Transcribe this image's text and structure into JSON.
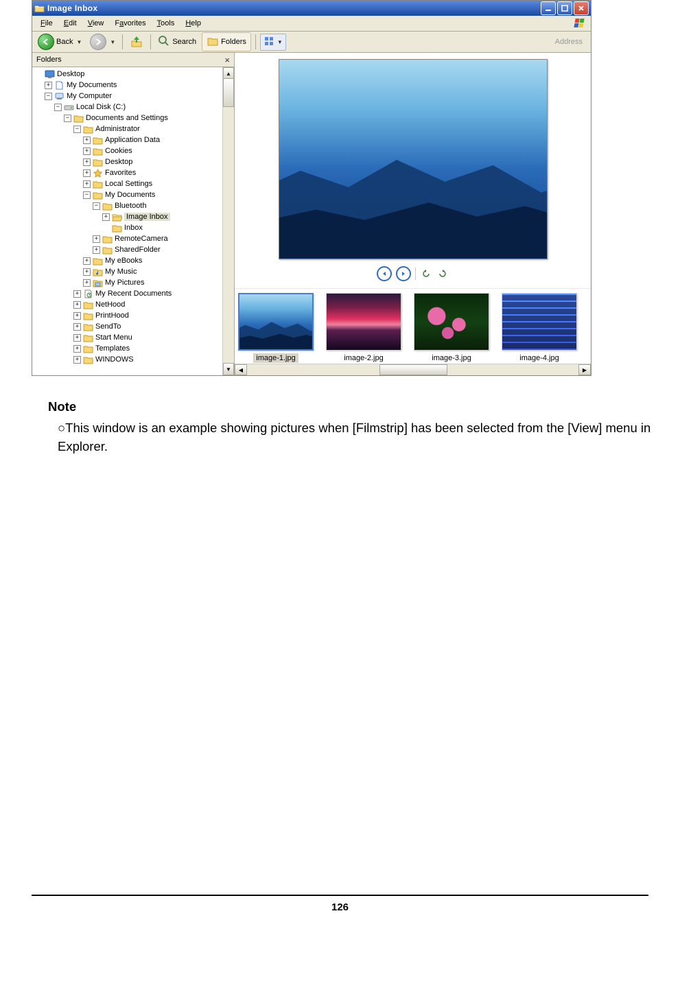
{
  "window": {
    "title": "Image Inbox"
  },
  "menubar": {
    "file": "File",
    "edit": "Edit",
    "view": "View",
    "favorites": "Favorites",
    "tools": "Tools",
    "help": "Help"
  },
  "toolbar": {
    "back": "Back",
    "search": "Search",
    "folders": "Folders",
    "address": "Address"
  },
  "folders_panel": {
    "title": "Folders",
    "tree": [
      {
        "ind": 0,
        "exp": "",
        "icon": "desktop",
        "label": "Desktop"
      },
      {
        "ind": 1,
        "exp": "+",
        "icon": "mydocs",
        "label": "My Documents"
      },
      {
        "ind": 1,
        "exp": "-",
        "icon": "mycomputer",
        "label": "My Computer"
      },
      {
        "ind": 2,
        "exp": "-",
        "icon": "disk",
        "label": "Local Disk (C:)"
      },
      {
        "ind": 3,
        "exp": "-",
        "icon": "folder",
        "label": "Documents and Settings"
      },
      {
        "ind": 4,
        "exp": "-",
        "icon": "folder",
        "label": "Administrator"
      },
      {
        "ind": 5,
        "exp": "+",
        "icon": "folder",
        "label": "Application Data"
      },
      {
        "ind": 5,
        "exp": "+",
        "icon": "folder",
        "label": "Cookies"
      },
      {
        "ind": 5,
        "exp": "+",
        "icon": "folder",
        "label": "Desktop"
      },
      {
        "ind": 5,
        "exp": "+",
        "icon": "favorites",
        "label": "Favorites"
      },
      {
        "ind": 5,
        "exp": "+",
        "icon": "folder",
        "label": "Local Settings"
      },
      {
        "ind": 5,
        "exp": "-",
        "icon": "folder",
        "label": "My Documents"
      },
      {
        "ind": 6,
        "exp": "-",
        "icon": "folder",
        "label": "Bluetooth"
      },
      {
        "ind": 7,
        "exp": "+",
        "icon": "folder-open",
        "label": "Image Inbox",
        "selected": true
      },
      {
        "ind": 7,
        "exp": "",
        "icon": "folder",
        "label": "Inbox"
      },
      {
        "ind": 6,
        "exp": "+",
        "icon": "folder",
        "label": "RemoteCamera"
      },
      {
        "ind": 6,
        "exp": "+",
        "icon": "folder",
        "label": "SharedFolder"
      },
      {
        "ind": 5,
        "exp": "+",
        "icon": "folder",
        "label": "My eBooks"
      },
      {
        "ind": 5,
        "exp": "+",
        "icon": "mymusic",
        "label": "My Music"
      },
      {
        "ind": 5,
        "exp": "+",
        "icon": "mypictures",
        "label": "My Pictures"
      },
      {
        "ind": 4,
        "exp": "+",
        "icon": "recentdocs",
        "label": "My Recent Documents"
      },
      {
        "ind": 4,
        "exp": "+",
        "icon": "folder",
        "label": "NetHood"
      },
      {
        "ind": 4,
        "exp": "+",
        "icon": "folder",
        "label": "PrintHood"
      },
      {
        "ind": 4,
        "exp": "+",
        "icon": "folder",
        "label": "SendTo"
      },
      {
        "ind": 4,
        "exp": "+",
        "icon": "folder",
        "label": "Start Menu"
      },
      {
        "ind": 4,
        "exp": "+",
        "icon": "folder",
        "label": "Templates"
      },
      {
        "ind": 4,
        "exp": "+",
        "icon": "folder",
        "label": "WINDOWS"
      }
    ]
  },
  "thumbnails": [
    {
      "label": "image-1.jpg",
      "art": "art-mountains",
      "selected": true
    },
    {
      "label": "image-2.jpg",
      "art": "art-sunset",
      "selected": false
    },
    {
      "label": "image-3.jpg",
      "art": "art-flowers",
      "selected": false
    },
    {
      "label": "image-4.jpg",
      "art": "art-wave",
      "selected": false
    }
  ],
  "note": {
    "heading": "Note",
    "body": "○This window is an example showing pictures when [Filmstrip] has been selected from the [View] menu in Explorer."
  },
  "page_number": "126"
}
